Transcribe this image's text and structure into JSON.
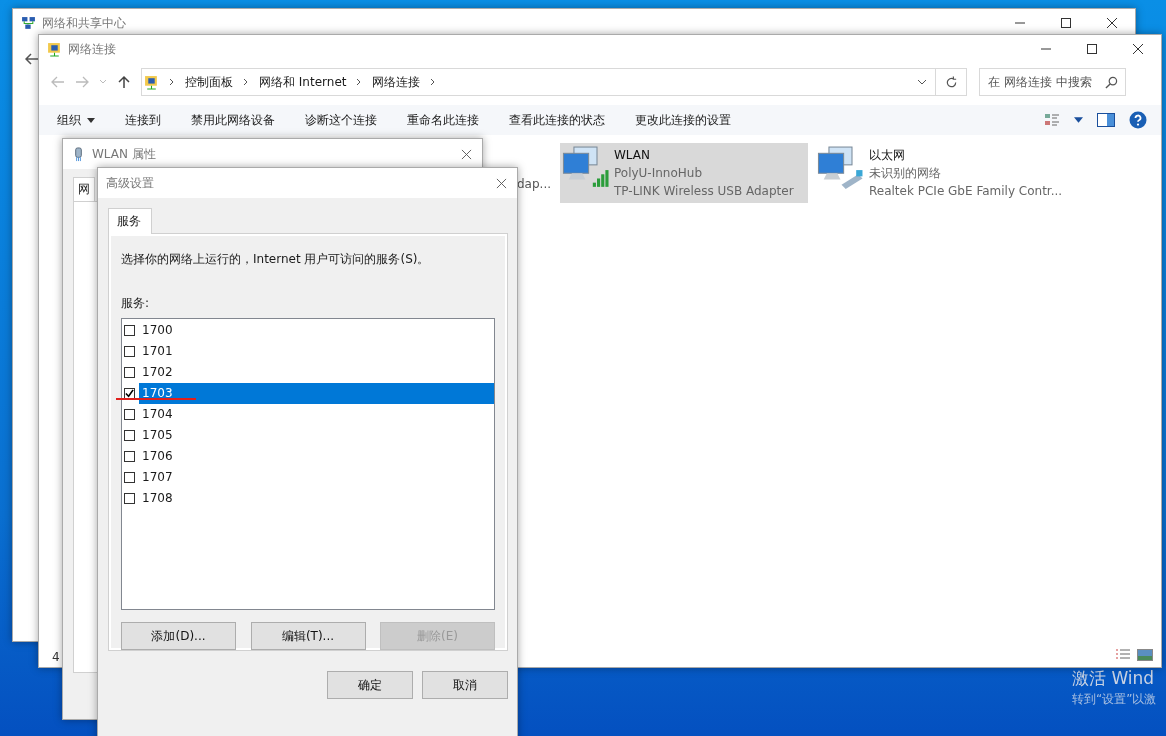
{
  "background_window": {
    "title": "网络和共享中心"
  },
  "network_connections": {
    "title": "网络连接",
    "breadcrumb": [
      "控制面板",
      "网络和 Internet",
      "网络连接"
    ],
    "search": {
      "placeholder": "在 网络连接 中搜索"
    },
    "toolbar": [
      {
        "label": "组织",
        "kind": "menu"
      },
      {
        "label": "连接到",
        "kind": "command"
      },
      {
        "label": "禁用此网络设备",
        "kind": "command"
      },
      {
        "label": "诊断这个连接",
        "kind": "command"
      },
      {
        "label": "重命名此连接",
        "kind": "command"
      },
      {
        "label": "查看此连接的状态",
        "kind": "command"
      },
      {
        "label": "更改此连接的设置",
        "kind": "command"
      }
    ],
    "partial_item_text": "dap...",
    "connections": [
      {
        "name": "WLAN",
        "network": "PolyU-InnoHub",
        "adapter": "TP-LINK Wireless USB Adapter",
        "kind": "wifi",
        "selected": true
      },
      {
        "name": "以太网",
        "network": "未识别的网络",
        "adapter": "Realtek PCIe GbE Family Contr...",
        "kind": "ethernet",
        "selected": false
      }
    ],
    "status_count": "4"
  },
  "wlan_properties": {
    "title": "WLAN 属性",
    "tab": "网"
  },
  "advanced": {
    "title": "高级设置",
    "tabs": [
      {
        "label": "服务",
        "selected": true
      }
    ],
    "description": "选择你的网络上运行的，Internet 用户可访问的服务(S)。",
    "list_label": "服务:",
    "services": [
      {
        "name": "1700",
        "checked": false,
        "selected": false
      },
      {
        "name": "1701",
        "checked": false,
        "selected": false
      },
      {
        "name": "1702",
        "checked": false,
        "selected": false
      },
      {
        "name": "1703",
        "checked": true,
        "selected": true
      },
      {
        "name": "1704",
        "checked": false,
        "selected": false
      },
      {
        "name": "1705",
        "checked": false,
        "selected": false
      },
      {
        "name": "1706",
        "checked": false,
        "selected": false
      },
      {
        "name": "1707",
        "checked": false,
        "selected": false
      },
      {
        "name": "1708",
        "checked": false,
        "selected": false
      }
    ],
    "buttons": [
      {
        "label": "添加(D)...",
        "disabled": false
      },
      {
        "label": "编辑(T)...",
        "disabled": false
      },
      {
        "label": "删除(E)",
        "disabled": true
      }
    ],
    "dialog_buttons": [
      "确定",
      "取消"
    ]
  },
  "desktop": {
    "activation_notice": [
      "激活 Wind",
      "转到“设置”以激"
    ]
  }
}
